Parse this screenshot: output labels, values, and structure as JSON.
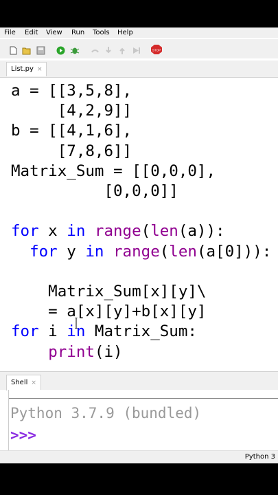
{
  "menu": [
    "File",
    "Edit",
    "View",
    "Run",
    "Tools",
    "Help"
  ],
  "toolbar": {
    "icons": [
      "new-file-icon",
      "open-folder-icon",
      "save-icon",
      "run-icon",
      "debug-icon",
      "step-over-icon",
      "step-into-icon",
      "step-out-icon",
      "resume-icon",
      "stop-icon"
    ],
    "stop_label": "STOP"
  },
  "editor_tab": {
    "label": "List.py",
    "close": "×"
  },
  "code_lines": [
    "a = [[3,5,8],",
    "     [4,2,9]]",
    "b = [[4,1,6],",
    "     [7,8,6]]",
    "Matrix_Sum = [[0,0,0],",
    "          [0,0,0]]",
    "",
    "for x in range(len(a)):",
    "  for y in range(len(a[0])):",
    "",
    "    Matrix_Sum[x][y]\\",
    "    = a[x][y]+b[x][y]",
    "for i in Matrix_Sum:",
    "    print(i)"
  ],
  "shell_tab": {
    "label": "Shell",
    "close": "×"
  },
  "shell": {
    "banner": "Python 3.7.9 (bundled)",
    "prompt": ">>>"
  },
  "status": {
    "text": "Python 3"
  },
  "colors": {
    "keyword": "#0000ff",
    "builtin": "#900090",
    "number": "#000000",
    "prompt": "#8a2be2",
    "banner": "#999999"
  }
}
